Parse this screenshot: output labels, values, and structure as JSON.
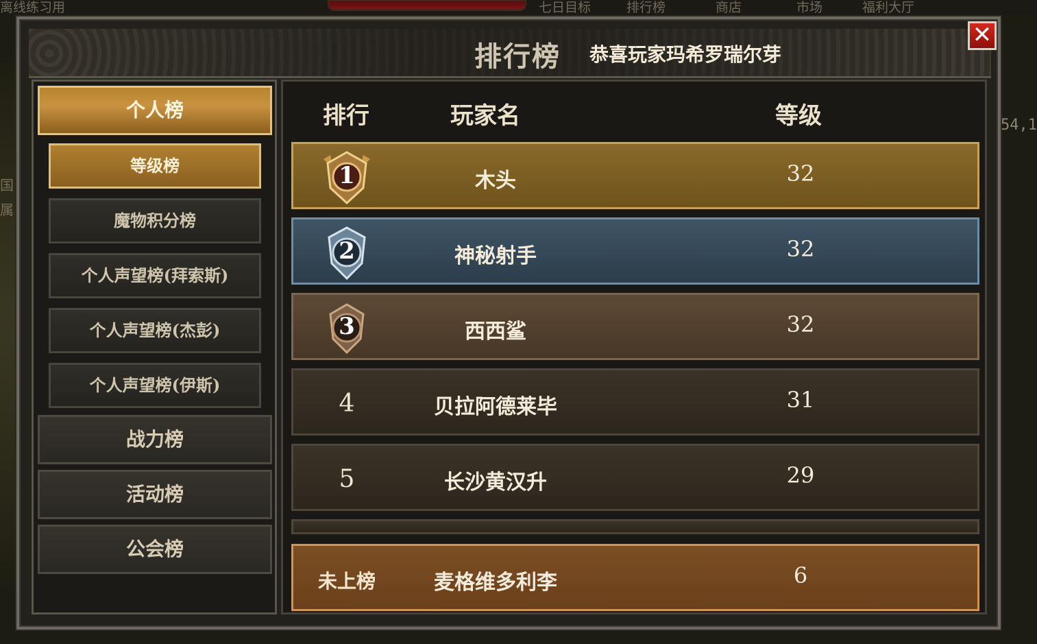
{
  "background": {
    "top_left_text": "离线练习用",
    "top_menu": [
      "七日目标",
      "排行榜",
      "商店",
      "市场",
      "福利大厅"
    ],
    "left_side_texts": [
      "国",
      "属"
    ],
    "right_side_text": "54,1"
  },
  "window": {
    "title": "排行榜",
    "announcement": "恭喜玩家玛希罗瑞尔芽",
    "close_label": "✕"
  },
  "categories": {
    "personal": "个人榜",
    "sub_items": [
      "等级榜",
      "魔物积分榜",
      "个人声望榜(拜索斯)",
      "个人声望榜(杰彭)",
      "个人声望榜(伊斯)"
    ],
    "power": "战力榜",
    "activity": "活动榜",
    "guild": "公会榜",
    "active_category": "个人榜",
    "active_sub": "等级榜"
  },
  "table": {
    "headers": {
      "rank": "排行",
      "player": "玩家名",
      "level": "等级"
    },
    "rows": [
      {
        "rank": "1",
        "name": "木头",
        "level": "32",
        "tier": "gold"
      },
      {
        "rank": "2",
        "name": "神秘射手",
        "level": "32",
        "tier": "silver"
      },
      {
        "rank": "3",
        "name": "西西鲨",
        "level": "32",
        "tier": "bronze"
      },
      {
        "rank": "4",
        "name": "贝拉阿德莱毕",
        "level": "31",
        "tier": "plain"
      },
      {
        "rank": "5",
        "name": "长沙黄汉升",
        "level": "29",
        "tier": "plain"
      }
    ],
    "self_row": {
      "rank_label": "未上榜",
      "name": "麦格维多利李",
      "level": "6"
    }
  },
  "colors": {
    "gold_row": "#8a6a2a",
    "silver_row": "#3f5566",
    "bronze_row": "#5d4a36",
    "self_row": "#7c4e24",
    "close_button": "#d6281c"
  },
  "icons": {
    "rank1": "gold-rank-badge-icon",
    "rank2": "silver-rank-badge-icon",
    "rank3": "bronze-rank-badge-icon",
    "close": "close-icon"
  }
}
